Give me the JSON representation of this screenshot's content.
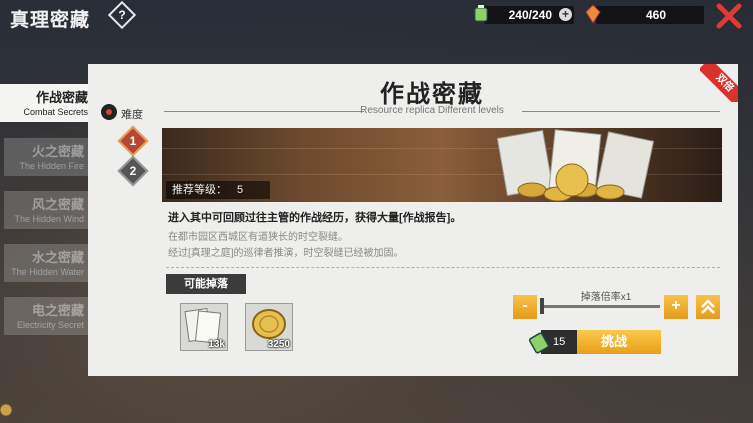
{
  "header": {
    "title": "真理密藏",
    "help_icon": "question-diamond-icon",
    "energy": {
      "value": "240/240",
      "icon": "energy-battery-icon"
    },
    "currency": {
      "value": "460",
      "icon": "crystal-icon"
    },
    "close_icon": "close-x-icon"
  },
  "sidebar": {
    "tabs": [
      {
        "zh": "作战密藏",
        "en": "Combat Secrets",
        "active": true
      },
      {
        "zh": "火之密藏",
        "en": "The Hidden Fire",
        "active": false
      },
      {
        "zh": "风之密藏",
        "en": "The Hidden Wind",
        "active": false
      },
      {
        "zh": "水之密藏",
        "en": "The Hidden Water",
        "active": false
      },
      {
        "zh": "电之密藏",
        "en": "Electricity Secret",
        "active": false
      }
    ]
  },
  "panel": {
    "title": "作战密藏",
    "subtitle": "Resource replica Different levels",
    "badge": "双倍",
    "difficulty_label": "难度",
    "levels": [
      "1",
      "2"
    ],
    "recommended_label": "推荐等级：",
    "recommended_value": "5",
    "description_main": "进入其中可回顾过往主管的作战经历，获得大量[作战报告]。",
    "description_lines": [
      "在都市园区西城区有道狭长的时空裂缝。",
      "经过[真理之庭]的巡律者推演，时空裂缝已经被加固。"
    ]
  },
  "drops": {
    "label": "可能掉落",
    "items": [
      {
        "icon": "combat-report-icon",
        "count": "13k"
      },
      {
        "icon": "gold-coin-icon",
        "count": "3250"
      }
    ]
  },
  "controls": {
    "rate_label": "掉落倍率x1",
    "minus": "-",
    "plus": "+",
    "max_icon": "double-chevron-up-icon",
    "rate_fill": 0.0,
    "cost": "15",
    "cost_icon": "energy-battery-icon",
    "challenge_label": "挑战"
  },
  "colors": {
    "accent": "#f2b233",
    "ribbon": "#d8322f",
    "close": "#e03a33"
  }
}
